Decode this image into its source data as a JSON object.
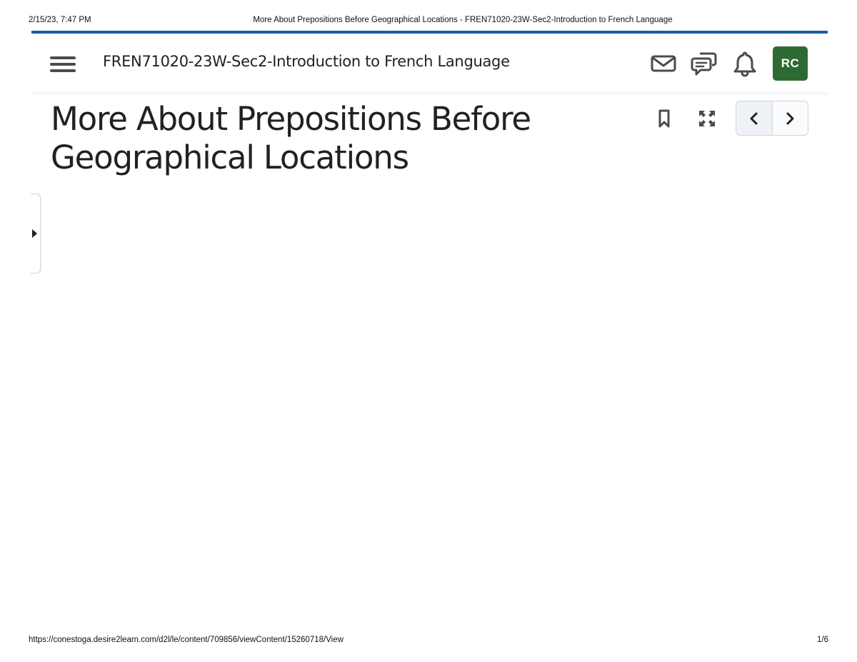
{
  "print_header": {
    "date_time": "2/15/23, 7:47 PM",
    "document_title": "More About Prepositions Before Geographical Locations - FREN71020-23W-Sec2-Introduction to French Language"
  },
  "navbar": {
    "course_name": "FREN71020-23W-Sec2-Introduction to French Language",
    "icons": [
      "menu-icon",
      "mail-icon",
      "chat-icon",
      "bell-icon"
    ],
    "avatar_initials": "RC",
    "avatar_color": "#2e6b34",
    "accent_color": "#1c5aa6"
  },
  "content": {
    "title_line1": "More About Prepositions Before",
    "title_line2": "Geographical Locations",
    "tools": [
      "bookmark-icon",
      "fullscreen-icon"
    ],
    "pager": [
      "previous-topic",
      "next-topic"
    ]
  },
  "print_footer": {
    "url": "https://conestoga.desire2learn.com/d2l/le/content/709856/viewContent/15260718/View",
    "page_number": "1/6"
  }
}
